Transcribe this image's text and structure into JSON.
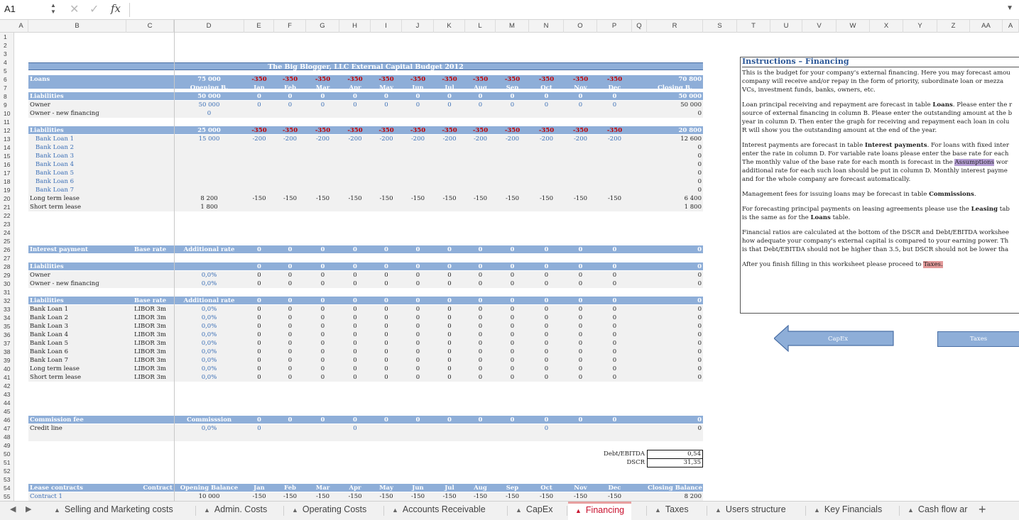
{
  "formula_bar": {
    "cell_ref": "A1",
    "fx": "fx",
    "formula": ""
  },
  "columns": [
    "A",
    "B",
    "C",
    "D",
    "E",
    "F",
    "G",
    "H",
    "I",
    "J",
    "K",
    "L",
    "M",
    "N",
    "O",
    "P",
    "Q",
    "R",
    "S",
    "T",
    "U",
    "V",
    "W",
    "X",
    "Y",
    "Z",
    "AA",
    "A"
  ],
  "rows": [
    "1",
    "2",
    "3",
    "4",
    "5",
    "6",
    "7",
    "8",
    "9",
    "10",
    "11",
    "12",
    "13",
    "14",
    "15",
    "16",
    "17",
    "18",
    "19",
    "20",
    "21",
    "22",
    "23",
    "24",
    "25",
    "26",
    "27",
    "28",
    "29",
    "30",
    "31",
    "32",
    "33",
    "34",
    "35",
    "36",
    "37",
    "38",
    "39",
    "40",
    "41",
    "42",
    "43",
    "44",
    "45",
    "46",
    "47",
    "48",
    "49",
    "50",
    "51",
    "52",
    "53",
    "54",
    "55"
  ],
  "sheet": {
    "title": "The Big Blogger, LLC External Capital Budget 2012",
    "header": {
      "opening": "Opening B.",
      "months": [
        "Jan",
        "Feb",
        "Mar",
        "Apr",
        "May",
        "Jun",
        "Jul",
        "Aug",
        "Sep",
        "Oct",
        "Nov",
        "Dec"
      ],
      "closing": "Closing B."
    },
    "loans": {
      "label": "Loans",
      "opening": "75 000",
      "monthly": "-350",
      "closing": "70 800"
    },
    "liab1": {
      "label": "Liabilities",
      "opening": "50 000",
      "monthly": "0",
      "closing": "50 000",
      "rows": [
        {
          "label": "Owner",
          "opening": "50 000",
          "monthly": "0",
          "closing": "50 000"
        },
        {
          "label": "Owner - new financing",
          "opening": "0",
          "monthly": "",
          "closing": "0"
        }
      ]
    },
    "liab2": {
      "label": "Liabilities",
      "opening": "25 000",
      "monthly": "-350",
      "closing": "20 800",
      "rows": [
        {
          "label": "Bank Loan 1",
          "opening": "15 000",
          "monthly": "-200",
          "closing": "12 600"
        },
        {
          "label": "Bank Loan 2",
          "opening": "",
          "monthly": "",
          "closing": "0"
        },
        {
          "label": "Bank Loan 3",
          "opening": "",
          "monthly": "",
          "closing": "0"
        },
        {
          "label": "Bank Loan 4",
          "opening": "",
          "monthly": "",
          "closing": "0"
        },
        {
          "label": "Bank Loan 5",
          "opening": "",
          "monthly": "",
          "closing": "0"
        },
        {
          "label": "Bank Loan 6",
          "opening": "",
          "monthly": "",
          "closing": "0"
        },
        {
          "label": "Bank Loan 7",
          "opening": "",
          "monthly": "",
          "closing": "0"
        },
        {
          "label": "Long term lease",
          "opening": "8 200",
          "monthly": "-150",
          "closing": "6 400"
        },
        {
          "label": "Short term lease",
          "opening": "1 800",
          "monthly": "",
          "closing": "1 800"
        }
      ]
    },
    "interest": {
      "label": "Interest payment",
      "base_rate": "Base rate",
      "add_rate": "Additional rate",
      "monthly": "0",
      "closing": "0"
    },
    "liab3": {
      "label": "Liabilities",
      "monthly": "0",
      "closing": "0",
      "rows": [
        {
          "label": "Owner",
          "rate": "0,0%",
          "monthly": "0",
          "closing": "0"
        },
        {
          "label": "Owner - new financing",
          "rate": "0,0%",
          "monthly": "0",
          "closing": "0"
        }
      ]
    },
    "liab4": {
      "label": "Liabilities",
      "base_rate": "Base rate",
      "add_rate": "Additional rate",
      "monthly": "0",
      "closing": "0",
      "rows": [
        {
          "label": "Bank Loan 1",
          "base": "LIBOR 3m",
          "rate": "0,0%",
          "monthly": "0",
          "closing": "0"
        },
        {
          "label": "Bank Loan 2",
          "base": "LIBOR 3m",
          "rate": "0,0%",
          "monthly": "0",
          "closing": "0"
        },
        {
          "label": "Bank Loan 3",
          "base": "LIBOR 3m",
          "rate": "0,0%",
          "monthly": "0",
          "closing": "0"
        },
        {
          "label": "Bank Loan 4",
          "base": "LIBOR 3m",
          "rate": "0,0%",
          "monthly": "0",
          "closing": "0"
        },
        {
          "label": "Bank Loan 5",
          "base": "LIBOR 3m",
          "rate": "0,0%",
          "monthly": "0",
          "closing": "0"
        },
        {
          "label": "Bank Loan 6",
          "base": "LIBOR 3m",
          "rate": "0,0%",
          "monthly": "0",
          "closing": "0"
        },
        {
          "label": "Bank Loan 7",
          "base": "LIBOR 3m",
          "rate": "0,0%",
          "monthly": "0",
          "closing": "0"
        },
        {
          "label": "Long term lease",
          "base": "LIBOR 3m",
          "rate": "0,0%",
          "monthly": "0",
          "closing": "0"
        },
        {
          "label": "Short term lease",
          "base": "LIBOR 3m",
          "rate": "0,0%",
          "monthly": "0",
          "closing": "0"
        }
      ]
    },
    "commission": {
      "label": "Commission fee",
      "col_label": "Commisssion",
      "monthly": "0",
      "closing": "0",
      "rows": [
        {
          "label": "Credit line",
          "rate": "0,0%",
          "jan": "0",
          "apr": "0",
          "oct": "0",
          "closing": "0"
        }
      ]
    },
    "kpis": [
      {
        "label": "Debt/EBITDA",
        "value": "0,54"
      },
      {
        "label": "DSCR",
        "value": "31,35"
      }
    ],
    "lease": {
      "label": "Lease contracts",
      "contract": "Contract",
      "opening": "Opening Balance",
      "closing": "Closing Balance",
      "row": {
        "label": "Contract 1",
        "opening": "10 000",
        "monthly": "-150",
        "closing": "8 200"
      }
    }
  },
  "instructions": {
    "title": "Instructions – Financing",
    "p1": [
      "This is the budget for your company's external financing. Here you may forecast amou",
      "company will receive and/or repay in the form of priority, subordinate loan or mezza",
      "VCs, investment funds, banks, owners, etc."
    ],
    "p2a": "Loan principal receiving and repayment are forecast in table ",
    "p2b": "Loans",
    "p2c": ". Please enter the r",
    "p2rest": [
      "source of external financing in column B. Please enter the outstanding amount at the b",
      "year in column D. Then enter the graph for receiving and repayment each loan in colu",
      "R will show you the outstanding amount at the end of the year."
    ],
    "p3a": "Interest payments are forecast in table ",
    "p3b": "Interest payments",
    "p3c": ". For loans with fixed inter",
    "p3l2": "enter the rate in column D. For variable rate loans please enter the base rate for each",
    "p3l3a": "The monthly value of the base rate for each month is forecast in the ",
    "p3l3b": "Assumptions",
    "p3l3c": " wor",
    "p3rest": [
      "additional rate for each such loan should be put in column D. Monthly interest payme",
      "and for the whole company are forecast automatically."
    ],
    "p4a": "Management fees for issuing loans may be forecast in table ",
    "p4b": "Commissions",
    "p4c": ".",
    "p5a": "For forecasting principal payments on leasing agreements please use the ",
    "p5b": "Leasing",
    "p5c": " tab",
    "p5l2a": "is the same as for the ",
    "p5l2b": "Loans",
    "p5l2c": " table.",
    "p6": [
      "Financial ratios are calculated at the bottom of the DSCR and Debt/EBITDA workshee",
      "how adequate your company's external capital is compared to your earning power. Th",
      "is that Debt/EBITDA should not be higher than 3.5, but DSCR should not be lower tha"
    ],
    "p7a": "After you finish filling in this worksheet please proceed to ",
    "p7b": "Taxes.",
    "nav_prev": "CapEx",
    "nav_next": "Taxes"
  },
  "tabs": [
    {
      "label": "Selling and Marketing costs",
      "active": false
    },
    {
      "label": "Admin. Costs",
      "active": false
    },
    {
      "label": "Operating Costs",
      "active": false
    },
    {
      "label": "Accounts Receivable",
      "active": false
    },
    {
      "label": "CapEx",
      "active": false
    },
    {
      "label": "Financing",
      "active": true
    },
    {
      "label": "Taxes",
      "active": false
    },
    {
      "label": "Users structure",
      "active": false
    },
    {
      "label": "Key Financials",
      "active": false
    },
    {
      "label": "Cash flow ar",
      "active": false
    }
  ]
}
